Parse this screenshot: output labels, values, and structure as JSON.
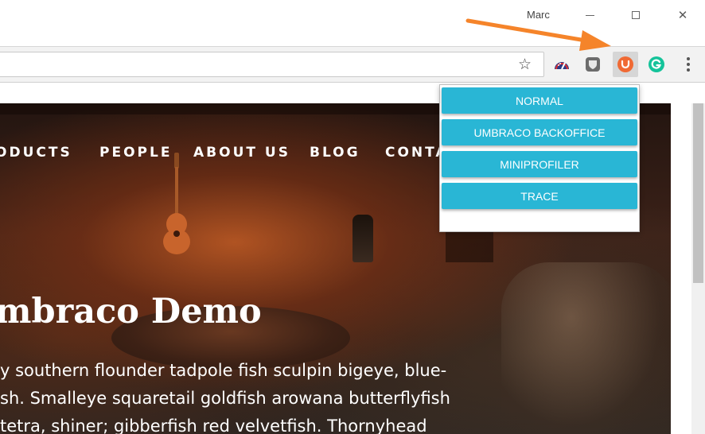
{
  "window": {
    "user_name": "Marc",
    "controls": [
      "minimize",
      "maximize",
      "close"
    ]
  },
  "toolbar": {
    "bookmark_icon": "star-icon",
    "extensions": [
      {
        "name": "speedometer-extension-icon"
      },
      {
        "name": "shield-extension-icon"
      },
      {
        "name": "umbraco-extension-icon",
        "active": true,
        "color": "#f06a34"
      },
      {
        "name": "grammarly-extension-icon",
        "color": "#15c39a"
      }
    ],
    "menu_icon": "kebab-menu-icon"
  },
  "site": {
    "nav": [
      "ODUCTS",
      "PEOPLE",
      "ABOUT US",
      "BLOG",
      "CONTA"
    ],
    "headline": "mbraco Demo",
    "body_lines": [
      "y southern flounder tadpole fish sculpin bigeye, blue-",
      "sh. Smalleye squaretail goldfish arowana butterflyfish",
      "tetra, shiner; gibberfish red velvetfish. Thornyhead"
    ]
  },
  "popup": {
    "accent_color": "#29b6d5",
    "buttons": [
      "NORMAL",
      "UMBRACO BACKOFFICE",
      "MINIPROFILER",
      "TRACE"
    ]
  },
  "annotation": {
    "arrow_color": "#f5842a"
  }
}
